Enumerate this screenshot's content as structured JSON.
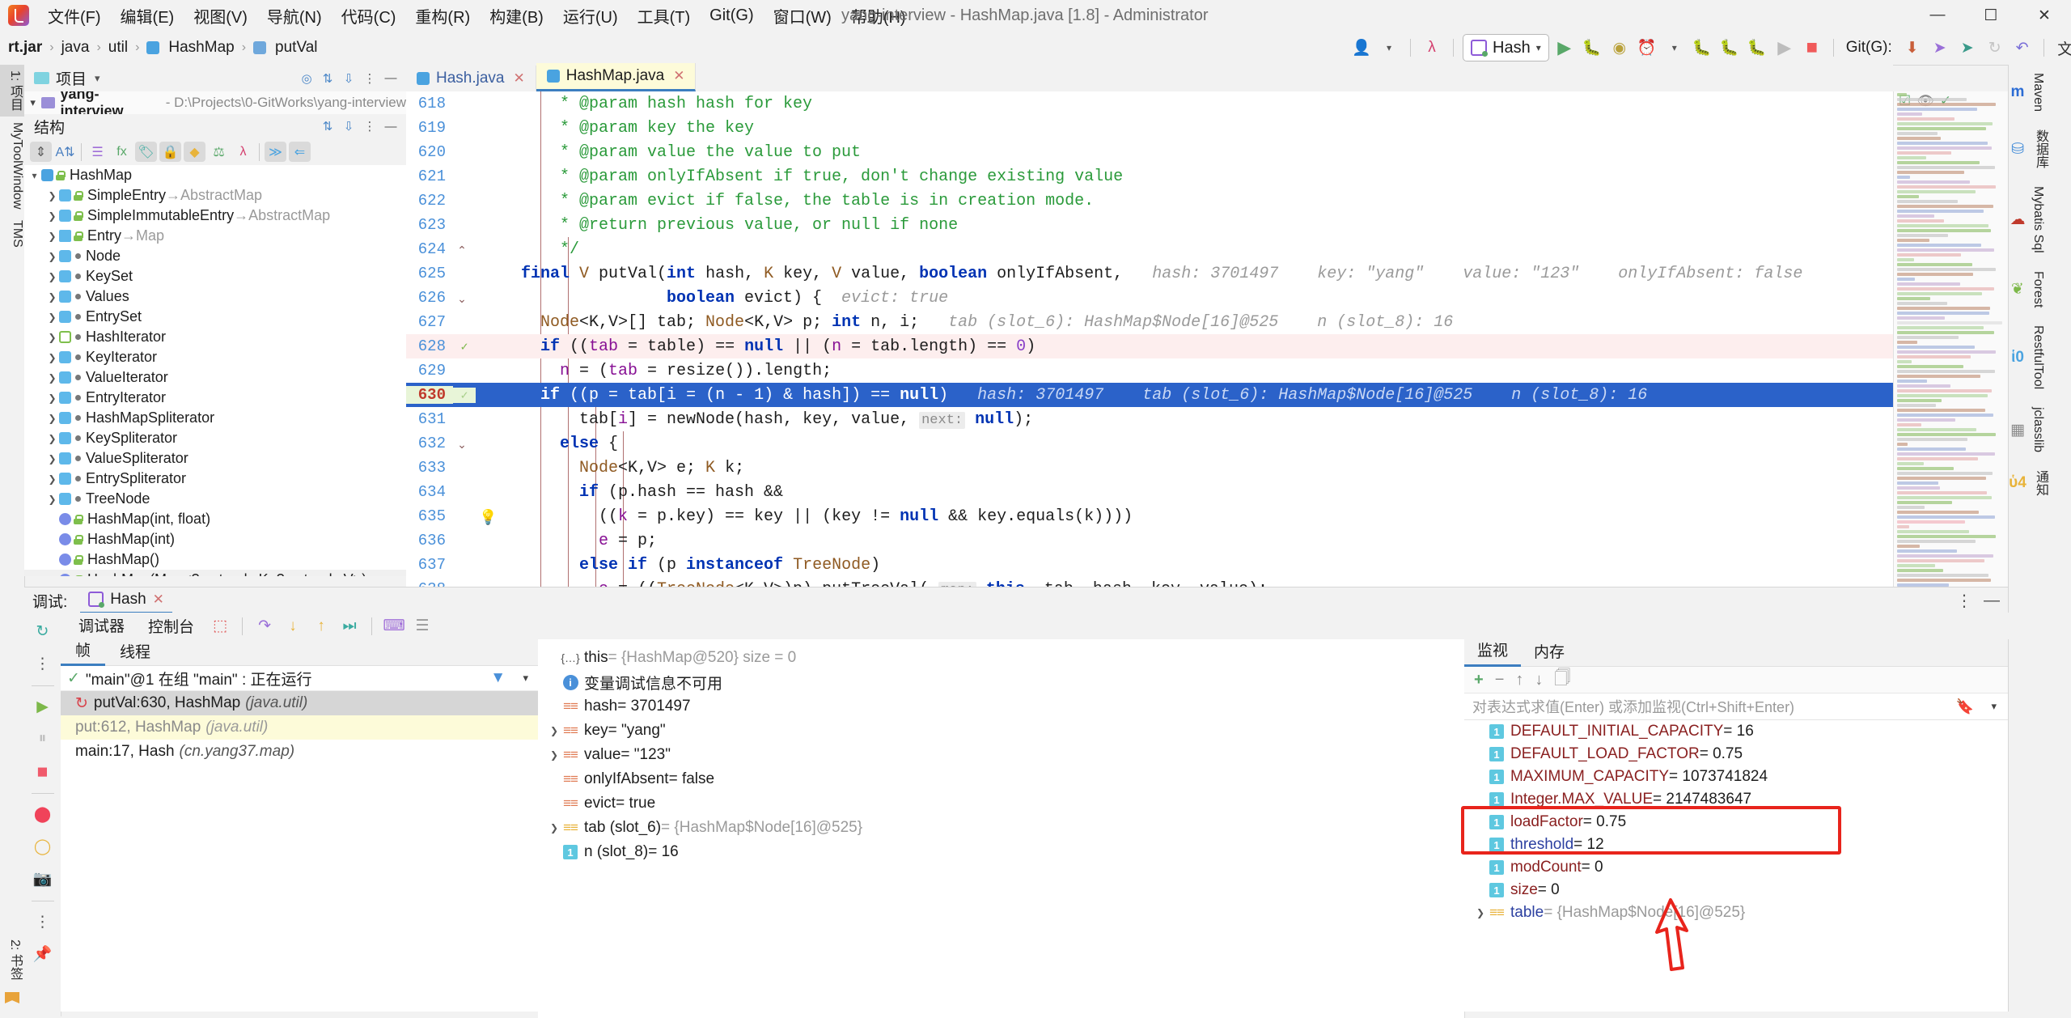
{
  "window": {
    "title": "yang-interview - HashMap.java [1.8] - Administrator",
    "minimize": "—",
    "maximize": "☐",
    "close": "✕"
  },
  "menu": [
    {
      "label": "文件(F)"
    },
    {
      "label": "编辑(E)"
    },
    {
      "label": "视图(V)"
    },
    {
      "label": "导航(N)"
    },
    {
      "label": "代码(C)"
    },
    {
      "label": "重构(R)"
    },
    {
      "label": "构建(B)"
    },
    {
      "label": "运行(U)"
    },
    {
      "label": "工具(T)"
    },
    {
      "label": "Git(G)"
    },
    {
      "label": "窗口(W)"
    },
    {
      "label": "帮助(H)"
    }
  ],
  "breadcrumb": {
    "items": [
      "rt.jar",
      "java",
      "util",
      "HashMap",
      "putVal"
    ],
    "sep": "›"
  },
  "toolbar": {
    "run_config": "Hash",
    "git_label": "Git(G):",
    "dropdown_arrow": "▾"
  },
  "left_strip": [
    {
      "label": "1: 项目",
      "selected": true
    },
    {
      "label": "MyToolWindow",
      "selected": false
    },
    {
      "label": "TMS",
      "selected": false
    }
  ],
  "left_strip_bottom": {
    "label": "2: 书签"
  },
  "right_strip": [
    {
      "label": "Maven",
      "icon": "m-icon"
    },
    {
      "label": "数据库",
      "icon": "database-icon"
    },
    {
      "label": "Mybatis Sql",
      "icon": "mybatis-icon"
    },
    {
      "label": "Forest",
      "icon": "leaf-icon"
    },
    {
      "label": "RestfulTool",
      "icon": "globe-icon"
    },
    {
      "label": "jclasslib",
      "icon": "class-icon"
    },
    {
      "label": "通知",
      "icon": "bell-icon"
    }
  ],
  "project_panel": {
    "title": "项目",
    "project_name": "yang-interview",
    "project_path": "- D:\\Projects\\0-GitWorks\\yang-interview"
  },
  "structure_panel": {
    "title": "结构",
    "items": [
      {
        "label": "HashMap",
        "super": "",
        "indent": 0,
        "expanded": true,
        "icon": "class-blue",
        "access": "lock"
      },
      {
        "label": "SimpleEntry",
        "super": "→AbstractMap",
        "indent": 1,
        "expanded": false,
        "icon": "class-inner",
        "access": "lock"
      },
      {
        "label": "SimpleImmutableEntry",
        "super": "→AbstractMap",
        "indent": 1,
        "expanded": false,
        "icon": "class-inner",
        "access": "lock"
      },
      {
        "label": "Entry",
        "super": "→Map",
        "indent": 1,
        "expanded": false,
        "icon": "interface",
        "access": "lock"
      },
      {
        "label": "Node",
        "super": "",
        "indent": 1,
        "expanded": false,
        "icon": "class-inner",
        "access": "dot"
      },
      {
        "label": "KeySet",
        "super": "",
        "indent": 1,
        "expanded": false,
        "icon": "class-blue2",
        "access": "dot"
      },
      {
        "label": "Values",
        "super": "",
        "indent": 1,
        "expanded": false,
        "icon": "class-blue2",
        "access": "dot"
      },
      {
        "label": "EntrySet",
        "super": "",
        "indent": 1,
        "expanded": false,
        "icon": "class-blue2",
        "access": "dot"
      },
      {
        "label": "HashIterator",
        "super": "",
        "indent": 1,
        "expanded": false,
        "icon": "abstract",
        "access": "dot"
      },
      {
        "label": "KeyIterator",
        "super": "",
        "indent": 1,
        "expanded": false,
        "icon": "class-blue2",
        "access": "dot"
      },
      {
        "label": "ValueIterator",
        "super": "",
        "indent": 1,
        "expanded": false,
        "icon": "class-blue2",
        "access": "dot"
      },
      {
        "label": "EntryIterator",
        "super": "",
        "indent": 1,
        "expanded": false,
        "icon": "class-blue2",
        "access": "dot"
      },
      {
        "label": "HashMapSpliterator",
        "super": "",
        "indent": 1,
        "expanded": false,
        "icon": "class-inner",
        "access": "dot"
      },
      {
        "label": "KeySpliterator",
        "super": "",
        "indent": 1,
        "expanded": false,
        "icon": "class-blue2",
        "access": "dot"
      },
      {
        "label": "ValueSpliterator",
        "super": "",
        "indent": 1,
        "expanded": false,
        "icon": "class-blue2",
        "access": "dot"
      },
      {
        "label": "EntrySpliterator",
        "super": "",
        "indent": 1,
        "expanded": false,
        "icon": "class-blue2",
        "access": "dot"
      },
      {
        "label": "TreeNode",
        "super": "",
        "indent": 1,
        "expanded": false,
        "icon": "class-blue2",
        "access": "dot"
      },
      {
        "label": "HashMap(int, float)",
        "super": "",
        "indent": 1,
        "expanded": null,
        "icon": "method",
        "access": "lock"
      },
      {
        "label": "HashMap(int)",
        "super": "",
        "indent": 1,
        "expanded": null,
        "icon": "method",
        "access": "lock"
      },
      {
        "label": "HashMap()",
        "super": "",
        "indent": 1,
        "expanded": null,
        "icon": "method",
        "access": "lock"
      },
      {
        "label": "HashMap(Map<? extends K, ? extends V>)",
        "super": "",
        "indent": 1,
        "expanded": null,
        "icon": "method",
        "access": "lock"
      }
    ]
  },
  "editor_tabs": [
    {
      "label": "Hash.java",
      "active": false
    },
    {
      "label": "HashMap.java",
      "active": true
    }
  ],
  "editor": {
    "lines": [
      {
        "num": "618",
        "indent": 8,
        "tokens": [
          {
            "t": "cmt",
            "v": "* @param hash hash for key"
          }
        ]
      },
      {
        "num": "619",
        "indent": 8,
        "tokens": [
          {
            "t": "cmt",
            "v": "* @param key the key"
          }
        ]
      },
      {
        "num": "620",
        "indent": 8,
        "tokens": [
          {
            "t": "cmt",
            "v": "* @param value the value to put"
          }
        ]
      },
      {
        "num": "621",
        "indent": 8,
        "tokens": [
          {
            "t": "cmt",
            "v": "* @param onlyIfAbsent if true, don't change existing value"
          }
        ]
      },
      {
        "num": "622",
        "indent": 8,
        "tokens": [
          {
            "t": "cmt",
            "v": "* @param evict if false, the table is in creation mode."
          }
        ]
      },
      {
        "num": "623",
        "indent": 8,
        "tokens": [
          {
            "t": "cmt",
            "v": "* @return previous value, or null if none"
          }
        ]
      },
      {
        "num": "624",
        "indent": 8,
        "fold": "⌃",
        "tokens": [
          {
            "t": "cmt",
            "v": "*/"
          }
        ]
      },
      {
        "num": "625",
        "indent": 4,
        "tokens": [
          {
            "t": "kw",
            "v": "final "
          },
          {
            "t": "typ",
            "v": "V "
          },
          {
            "t": "pln",
            "v": "putVal("
          },
          {
            "t": "kw",
            "v": "int"
          },
          {
            "t": "pln",
            "v": " hash, "
          },
          {
            "t": "typ",
            "v": "K "
          },
          {
            "t": "pln",
            "v": "key, "
          },
          {
            "t": "typ",
            "v": "V "
          },
          {
            "t": "pln",
            "v": "value, "
          },
          {
            "t": "kw",
            "v": "boolean"
          },
          {
            "t": "pln",
            "v": " onlyIfAbsent,"
          },
          {
            "t": "hint",
            "v": "   hash: 3701497    key: \"yang\"    value: \"123\"    onlyIfAbsent: false"
          }
        ]
      },
      {
        "num": "626",
        "indent": 19,
        "fold": "⌄",
        "tokens": [
          {
            "t": "kw",
            "v": "boolean"
          },
          {
            "t": "pln",
            "v": " evict) {"
          },
          {
            "t": "hint",
            "v": "  evict: true"
          }
        ]
      },
      {
        "num": "627",
        "indent": 6,
        "tokens": [
          {
            "t": "typ",
            "v": "Node"
          },
          {
            "t": "pln",
            "v": "<K,V>[] tab; "
          },
          {
            "t": "typ",
            "v": "Node"
          },
          {
            "t": "pln",
            "v": "<K,V> p; "
          },
          {
            "t": "kw",
            "v": "int"
          },
          {
            "t": "pln",
            "v": " n, i;"
          },
          {
            "t": "hint",
            "v": "   tab (slot_6): HashMap$Node[16]@525    n (slot_8): 16"
          }
        ]
      },
      {
        "num": "628",
        "indent": 6,
        "mark": "check",
        "bg": "pink",
        "tokens": [
          {
            "t": "kw",
            "v": "if"
          },
          {
            "t": "pln",
            "v": " (("
          },
          {
            "t": "fld",
            "v": "tab"
          },
          {
            "t": "pln",
            "v": " = table) == "
          },
          {
            "t": "kw",
            "v": "null"
          },
          {
            "t": "pln",
            "v": " || ("
          },
          {
            "t": "fld",
            "v": "n"
          },
          {
            "t": "pln",
            "v": " = tab.length) == "
          },
          {
            "t": "num",
            "v": "0"
          },
          {
            "t": "pln",
            "v": ")"
          }
        ]
      },
      {
        "num": "629",
        "indent": 8,
        "tokens": [
          {
            "t": "fld",
            "v": "n"
          },
          {
            "t": "pln",
            "v": " = ("
          },
          {
            "t": "fld",
            "v": "tab"
          },
          {
            "t": "pln",
            "v": " = resize()).length;"
          }
        ]
      },
      {
        "num": "630",
        "indent": 6,
        "mark": "bulb",
        "bg": "blue",
        "tokens": [
          {
            "t": "kw",
            "v": "if"
          },
          {
            "t": "pln",
            "v": " (("
          },
          {
            "t": "fld",
            "v": "p"
          },
          {
            "t": "pln",
            "v": " = tab["
          },
          {
            "t": "fld",
            "v": "i"
          },
          {
            "t": "pln",
            "v": " = (n - "
          },
          {
            "t": "num",
            "v": "1"
          },
          {
            "t": "pln",
            "v": ") & hash]) == "
          },
          {
            "t": "kw",
            "v": "null"
          },
          {
            "t": "pln",
            "v": ")"
          },
          {
            "t": "hint",
            "v": "   hash: 3701497    tab (slot_6): HashMap$Node[16]@525    n (slot_8): 16"
          }
        ]
      },
      {
        "num": "631",
        "indent": 10,
        "tokens": [
          {
            "t": "pln",
            "v": "tab["
          },
          {
            "t": "fld",
            "v": "i"
          },
          {
            "t": "pln",
            "v": "] = newNode(hash, key, value, "
          },
          {
            "t": "hintb",
            "v": "next:"
          },
          {
            "t": "kw",
            "v": " null"
          },
          {
            "t": "pln",
            "v": ");"
          }
        ]
      },
      {
        "num": "632",
        "indent": 8,
        "fold": "⌄",
        "tokens": [
          {
            "t": "kw",
            "v": "else"
          },
          {
            "t": "pln",
            "v": " {"
          }
        ]
      },
      {
        "num": "633",
        "indent": 10,
        "tokens": [
          {
            "t": "typ",
            "v": "Node"
          },
          {
            "t": "pln",
            "v": "<K,V> e; "
          },
          {
            "t": "typ",
            "v": "K "
          },
          {
            "t": "pln",
            "v": "k;"
          }
        ]
      },
      {
        "num": "634",
        "indent": 10,
        "tokens": [
          {
            "t": "kw",
            "v": "if"
          },
          {
            "t": "pln",
            "v": " (p.hash == hash &&"
          }
        ]
      },
      {
        "num": "635",
        "indent": 12,
        "tokens": [
          {
            "t": "pln",
            "v": "(("
          },
          {
            "t": "fld",
            "v": "k"
          },
          {
            "t": "pln",
            "v": " = p.key) == key || (key != "
          },
          {
            "t": "kw",
            "v": "null"
          },
          {
            "t": "pln",
            "v": " && key.equals(k))))"
          }
        ]
      },
      {
        "num": "636",
        "indent": 12,
        "tokens": [
          {
            "t": "fld",
            "v": "e"
          },
          {
            "t": "pln",
            "v": " = p;"
          }
        ]
      },
      {
        "num": "637",
        "indent": 10,
        "tokens": [
          {
            "t": "kw",
            "v": "else if"
          },
          {
            "t": "pln",
            "v": " (p "
          },
          {
            "t": "kw",
            "v": "instanceof"
          },
          {
            "t": "pln",
            "v": " "
          },
          {
            "t": "typ",
            "v": "TreeNode"
          },
          {
            "t": "pln",
            "v": ")"
          }
        ]
      },
      {
        "num": "638",
        "indent": 12,
        "clipped": true,
        "tokens": [
          {
            "t": "fld",
            "v": "e"
          },
          {
            "t": "pln",
            "v": " = (("
          },
          {
            "t": "typ",
            "v": "TreeNode"
          },
          {
            "t": "pln",
            "v": "<K,V>)p).putTreeVal( "
          },
          {
            "t": "hintb",
            "v": "map:"
          },
          {
            "t": "kw",
            "v": " this"
          },
          {
            "t": "pln",
            "v": ", tab, hash, key, value);"
          }
        ]
      }
    ]
  },
  "debug_panel": {
    "label": "调试:",
    "session_tab": "Hash",
    "tabs": [
      {
        "label": "调试器",
        "active": true
      },
      {
        "label": "控制台",
        "active": false
      }
    ],
    "frame_tabs": [
      {
        "label": "帧",
        "active": true
      },
      {
        "label": "线程",
        "active": false
      }
    ],
    "thread": "\"main\"@1 在组 \"main\" : 正在运行",
    "frames": [
      {
        "label": "putVal:630, HashMap",
        "pkg": "(java.util)",
        "state": "selected"
      },
      {
        "label": "put:612, HashMap",
        "pkg": "(java.util)",
        "state": "warn"
      },
      {
        "label": "main:17, Hash",
        "pkg": "(cn.yang37.map)",
        "state": "normal"
      }
    ],
    "variables": [
      {
        "icon": "object",
        "name": "this",
        "value": "= {HashMap@520}  size = 0",
        "expandable": false,
        "gray_value": true
      },
      {
        "icon": "info",
        "name": "变量调试信息不可用",
        "value": "",
        "expandable": false,
        "info": true
      },
      {
        "icon": "field",
        "name": "hash",
        "value": "= 3701497",
        "expandable": false
      },
      {
        "icon": "field",
        "name": "key",
        "value": "= \"yang\"",
        "expandable": true
      },
      {
        "icon": "field",
        "name": "value",
        "value": "= \"123\"",
        "expandable": true
      },
      {
        "icon": "field",
        "name": "onlyIfAbsent",
        "value": "= false",
        "expandable": false
      },
      {
        "icon": "field",
        "name": "evict",
        "value": "= true",
        "expandable": false
      },
      {
        "icon": "array",
        "name": "tab (slot_6)",
        "value": "= {HashMap$Node[16]@525}",
        "expandable": true,
        "gray_value": true
      },
      {
        "icon": "num",
        "name": "n (slot_8)",
        "value": "= 16",
        "expandable": false
      }
    ]
  },
  "watch_panel": {
    "tabs": [
      {
        "label": "监视",
        "active": true
      },
      {
        "label": "内存",
        "active": false
      }
    ],
    "toolbar_icons": [
      "plus-icon",
      "minus-icon",
      "arrow-up-icon",
      "arrow-down-icon",
      "copy-icon"
    ],
    "expression_placeholder": "对表达式求值(Enter) 或添加监视(Ctrl+Shift+Enter)",
    "items": [
      {
        "icon": "num",
        "name": "DEFAULT_INITIAL_CAPACITY",
        "value": "= 16",
        "expandable": false,
        "highlight": false
      },
      {
        "icon": "num",
        "name": "DEFAULT_LOAD_FACTOR",
        "value": "= 0.75",
        "expandable": false,
        "highlight": false
      },
      {
        "icon": "num",
        "name": "MAXIMUM_CAPACITY",
        "value": "= 1073741824",
        "expandable": false,
        "highlight": false
      },
      {
        "icon": "num",
        "name": "Integer.MAX_VALUE",
        "value": "= 2147483647",
        "expandable": false,
        "highlight": false
      },
      {
        "icon": "num",
        "name": "loadFactor",
        "value": "= 0.75",
        "expandable": false,
        "highlight": true
      },
      {
        "icon": "num",
        "name": "threshold",
        "value": "= 12",
        "expandable": false,
        "highlight": true,
        "blue": true
      },
      {
        "icon": "num",
        "name": "modCount",
        "value": "= 0",
        "expandable": false,
        "highlight": false
      },
      {
        "icon": "num",
        "name": "size",
        "value": "= 0",
        "expandable": false,
        "highlight": false
      },
      {
        "icon": "array",
        "name": "table",
        "value": "= {HashMap$Node[16]@525}",
        "expandable": true,
        "highlight": false,
        "blue": true,
        "gray_value": true
      }
    ]
  },
  "annotation": {
    "box_color": "#e8241c",
    "arrow_color": "#e8241c"
  }
}
